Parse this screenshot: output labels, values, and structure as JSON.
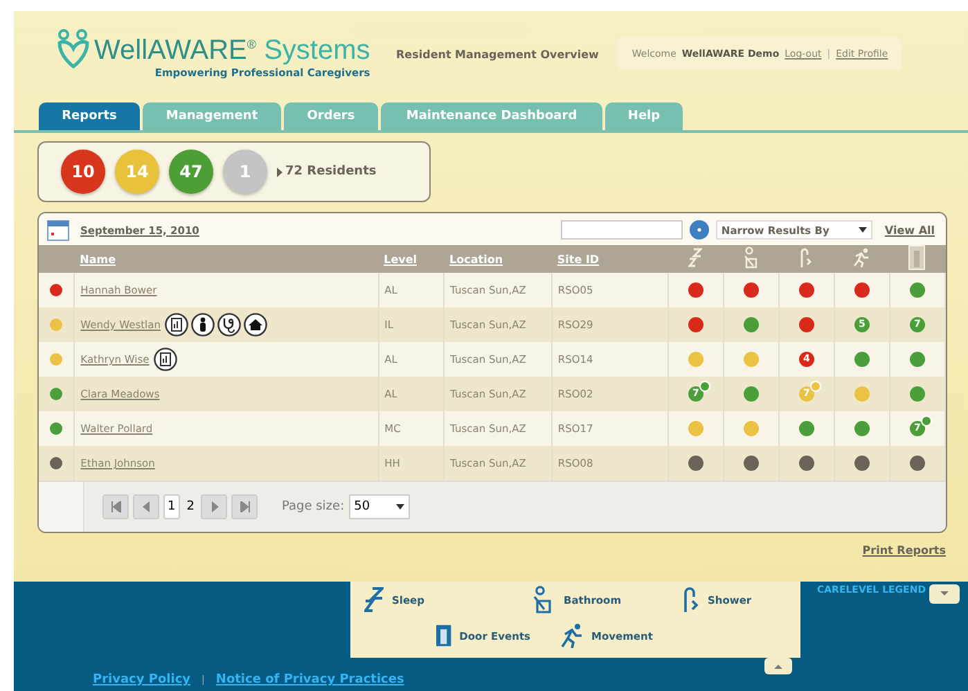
{
  "header": {
    "brand": "WellAWARE",
    "brand_mark": "®",
    "brand_suffix": "Systems",
    "tagline": "Empowering Professional Caregivers",
    "page_title": "Resident Management Overview",
    "welcome": "Welcome",
    "user": "WellAWARE Demo",
    "links": [
      "Log-out",
      "Edit Profile"
    ],
    "separator": "|"
  },
  "tabs": [
    {
      "label": "Reports",
      "selected": true
    },
    {
      "label": "Management",
      "selected": false
    },
    {
      "label": "Orders",
      "selected": false
    },
    {
      "label": "Maintenance Dashboard",
      "selected": false
    },
    {
      "label": "Help",
      "selected": false
    }
  ],
  "summary": {
    "counts": [
      {
        "value": "10",
        "color": "#d8361c"
      },
      {
        "value": "14",
        "color": "#e9c23c"
      },
      {
        "value": "47",
        "color": "#4e9e36"
      },
      {
        "value": "1",
        "color": "#c4c4c4"
      }
    ],
    "total": "72 Residents"
  },
  "table": {
    "date": "September 15, 2010",
    "filter": "Narrow Results By",
    "view_all": "View All",
    "columns": [
      {
        "label": "Name"
      },
      {
        "label": "Level"
      },
      {
        "label": "Location"
      },
      {
        "label": "Site ID"
      },
      {
        "kind": "sleep"
      },
      {
        "kind": "bathroom"
      },
      {
        "kind": "shower"
      },
      {
        "kind": "movement"
      },
      {
        "kind": "door"
      }
    ],
    "rows": [
      {
        "color": "#d9291b",
        "name": "Hannah Bower",
        "icons": [],
        "level": "AL",
        "location": "Tuscan Sun,AZ",
        "site": "RSO05",
        "cells": [
          {
            "color": "#d9291b"
          },
          {
            "color": "#d9291b"
          },
          {
            "color": "#d9291b"
          },
          {
            "color": "#d9291b"
          },
          {
            "color": "#4a9f3a"
          }
        ]
      },
      {
        "color": "#ecc245",
        "name": "Wendy Westlan",
        "icons": [
          {
            "kind": "report"
          },
          {
            "kind": "person"
          },
          {
            "kind": "stethoscope"
          },
          {
            "kind": "home"
          }
        ],
        "level": "IL",
        "location": "Tuscan Sun,AZ",
        "site": "RSO29",
        "cells": [
          {
            "color": "#d9291b"
          },
          {
            "color": "#4a9f3a"
          },
          {
            "color": "#d9291b"
          },
          {
            "color": "#4a9f3a",
            "count": "5"
          },
          {
            "color": "#4a9f3a",
            "count": "7"
          }
        ]
      },
      {
        "color": "#ecc245",
        "name": "Kathryn Wise",
        "icons": [
          {
            "kind": "report"
          }
        ],
        "level": "AL",
        "location": "Tuscan Sun,AZ",
        "site": "RSO14",
        "cells": [
          {
            "color": "#ecc245"
          },
          {
            "color": "#ecc245"
          },
          {
            "color": "#d9291b",
            "count": "4"
          },
          {
            "color": "#4a9f3a"
          },
          {
            "color": "#4a9f3a"
          }
        ]
      },
      {
        "color": "#4a9f3a",
        "name": "Clara Meadows",
        "icons": [],
        "level": "AL",
        "location": "Tuscan Sun,AZ",
        "site": "RSO02",
        "cells": [
          {
            "color": "#4a9f3a",
            "count": "7",
            "plus": true
          },
          {
            "color": "#4a9f3a"
          },
          {
            "color": "#ecc245",
            "count": "7",
            "plus": true
          },
          {
            "color": "#ecc245"
          },
          {
            "color": "#4a9f3a"
          }
        ]
      },
      {
        "color": "#4a9f3a",
        "name": "Walter Pollard",
        "icons": [],
        "level": "MC",
        "location": "Tuscan Sun,AZ",
        "site": "RSO17",
        "cells": [
          {
            "color": "#ecc245"
          },
          {
            "color": "#ecc245"
          },
          {
            "color": "#4a9f3a"
          },
          {
            "color": "#4a9f3a"
          },
          {
            "color": "#4a9f3a",
            "count": "7",
            "plus": true
          }
        ]
      },
      {
        "color": "#6b6358",
        "name": "Ethan Johnson",
        "icons": [],
        "level": "HH",
        "location": "Tuscan Sun,AZ",
        "site": "RSO08",
        "cells": [
          {
            "color": "#6b6358"
          },
          {
            "color": "#6b6358"
          },
          {
            "color": "#6b6358"
          },
          {
            "color": "#6b6358"
          },
          {
            "color": "#6b6358"
          }
        ]
      }
    ],
    "pager": {
      "buttons": [
        {
          "kind": "first"
        },
        {
          "kind": "prev"
        }
      ],
      "pages": [
        {
          "label": "1",
          "selected": true
        },
        {
          "label": "2",
          "selected": false
        }
      ],
      "buttons_after": [
        {
          "kind": "next"
        },
        {
          "kind": "last"
        }
      ],
      "size_label": "Page size:",
      "size": "50"
    }
  },
  "print": "Print Reports",
  "legend": {
    "title": "CARELEVEL LEGEND",
    "items": [
      {
        "kind": "sleep",
        "label": "Sleep"
      },
      {
        "kind": "bathroom",
        "label": "Bathroom"
      },
      {
        "kind": "shower",
        "label": "Shower"
      },
      {
        "kind": "door",
        "label": "Door Events"
      },
      {
        "kind": "movement",
        "label": "Movement"
      }
    ]
  },
  "footer": {
    "links": [
      "Privacy Policy",
      "Notice of Privacy Practices"
    ],
    "separator": "|"
  }
}
